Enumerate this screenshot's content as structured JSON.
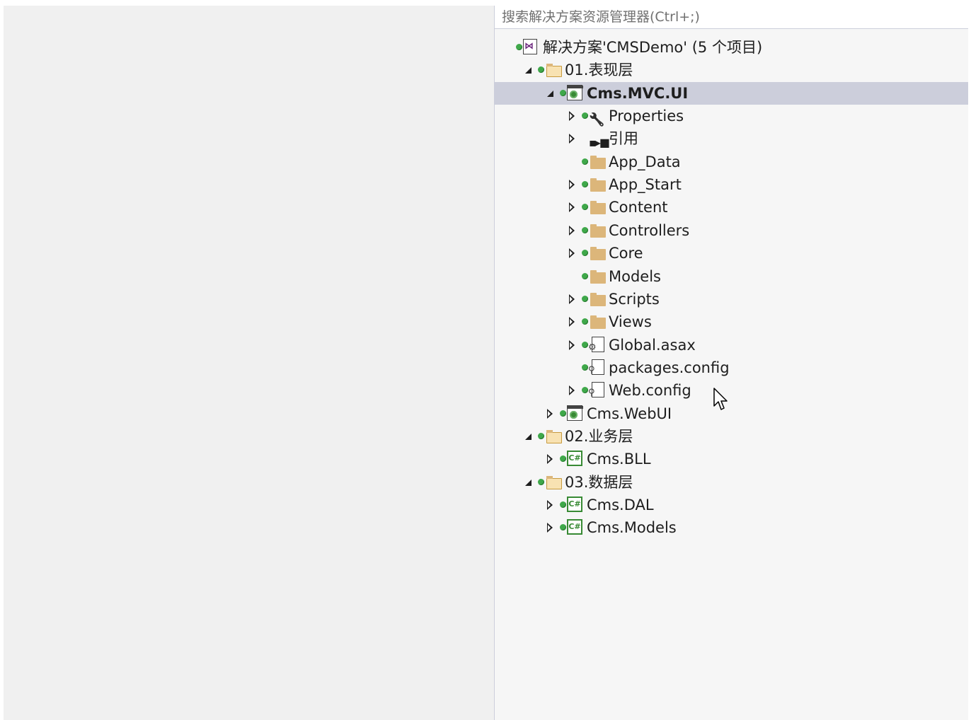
{
  "search": {
    "placeholder": "搜索解决方案资源管理器(Ctrl+;)"
  },
  "tree": [
    {
      "label": "解决方案'CMSDemo' (5 个项目)",
      "icon": "solution-icon",
      "expander": "none",
      "indent": 0,
      "dot": true
    },
    {
      "label": "01.表现层",
      "icon": "solution-folder-icon",
      "expander": "open",
      "indent": 1,
      "dot": true
    },
    {
      "label": "Cms.MVC.UI",
      "icon": "web-project-icon",
      "expander": "open",
      "indent": 2,
      "dot": true,
      "selected": true,
      "bold": true
    },
    {
      "label": "Properties",
      "icon": "wrench-icon",
      "expander": "closed",
      "indent": 3,
      "dot": true
    },
    {
      "label": "引用",
      "icon": "references-icon",
      "expander": "closed",
      "indent": 3,
      "dot": false
    },
    {
      "label": "App_Data",
      "icon": "folder-icon",
      "expander": "none",
      "indent": 3,
      "dot": true
    },
    {
      "label": "App_Start",
      "icon": "folder-icon",
      "expander": "closed",
      "indent": 3,
      "dot": true
    },
    {
      "label": "Content",
      "icon": "folder-icon",
      "expander": "closed",
      "indent": 3,
      "dot": true
    },
    {
      "label": "Controllers",
      "icon": "folder-icon",
      "expander": "closed",
      "indent": 3,
      "dot": true
    },
    {
      "label": "Core",
      "icon": "folder-icon",
      "expander": "closed",
      "indent": 3,
      "dot": true
    },
    {
      "label": "Models",
      "icon": "folder-icon",
      "expander": "none",
      "indent": 3,
      "dot": true
    },
    {
      "label": "Scripts",
      "icon": "folder-icon",
      "expander": "closed",
      "indent": 3,
      "dot": true
    },
    {
      "label": "Views",
      "icon": "folder-icon",
      "expander": "closed",
      "indent": 3,
      "dot": true
    },
    {
      "label": "Global.asax",
      "icon": "global-asax-file-icon",
      "expander": "closed",
      "indent": 3,
      "dot": true
    },
    {
      "label": "packages.config",
      "icon": "config-file-icon",
      "expander": "none",
      "indent": 3,
      "dot": true
    },
    {
      "label": "Web.config",
      "icon": "config-file-icon",
      "expander": "closed",
      "indent": 3,
      "dot": true
    },
    {
      "label": "Cms.WebUI",
      "icon": "web-project-icon",
      "expander": "closed",
      "indent": 2,
      "dot": true
    },
    {
      "label": "02.业务层",
      "icon": "solution-folder-icon",
      "expander": "open",
      "indent": 1,
      "dot": true
    },
    {
      "label": "Cms.BLL",
      "icon": "csharp-project-icon",
      "expander": "closed",
      "indent": 2,
      "dot": true
    },
    {
      "label": "03.数据层",
      "icon": "solution-folder-icon",
      "expander": "open",
      "indent": 1,
      "dot": true
    },
    {
      "label": "Cms.DAL",
      "icon": "csharp-project-icon",
      "expander": "closed",
      "indent": 2,
      "dot": true
    },
    {
      "label": "Cms.Models",
      "icon": "csharp-project-icon",
      "expander": "closed",
      "indent": 2,
      "dot": true
    }
  ],
  "csharp_icon_text": "C#",
  "colors": {
    "selection": "#cccedb",
    "background": "#f6f6f6",
    "status_dot": "#3fa84a",
    "folder": "#dcb67a"
  }
}
